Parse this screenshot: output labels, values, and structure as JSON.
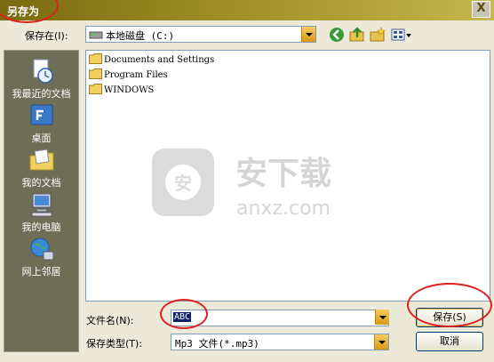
{
  "window": {
    "title": "另存为",
    "close_glyph": "X"
  },
  "save_in": {
    "label": "保存在(I):",
    "value": "本地磁盘 (C:)",
    "drive_icon": "drive-icon"
  },
  "toolbar": {
    "icons": [
      "back-icon",
      "up-folder-icon",
      "new-folder-icon",
      "view-menu-icon"
    ]
  },
  "places": [
    {
      "label": "我最近的文档",
      "icon": "recent-documents-icon"
    },
    {
      "label": "桌面",
      "icon": "desktop-icon"
    },
    {
      "label": "我的文档",
      "icon": "my-documents-icon"
    },
    {
      "label": "我的电脑",
      "icon": "my-computer-icon"
    },
    {
      "label": "网上邻居",
      "icon": "network-places-icon"
    }
  ],
  "files": [
    {
      "name": "Documents and Settings",
      "icon": "folder-icon"
    },
    {
      "name": "Program Files",
      "icon": "folder-icon"
    },
    {
      "name": "WINDOWS",
      "icon": "folder-icon"
    }
  ],
  "file_name": {
    "label": "文件名(N):",
    "value": "ABC"
  },
  "file_type": {
    "label": "保存类型(T):",
    "value": "Mp3 文件(*.mp3)"
  },
  "buttons": {
    "save": "保存(S)",
    "cancel": "取消"
  },
  "watermark": {
    "main": "安下载",
    "sub": "anxz.com",
    "badge": "安"
  },
  "colors": {
    "highlight": "#0a246a",
    "annotation": "#e02020",
    "title_bar": "#9b8a22"
  }
}
